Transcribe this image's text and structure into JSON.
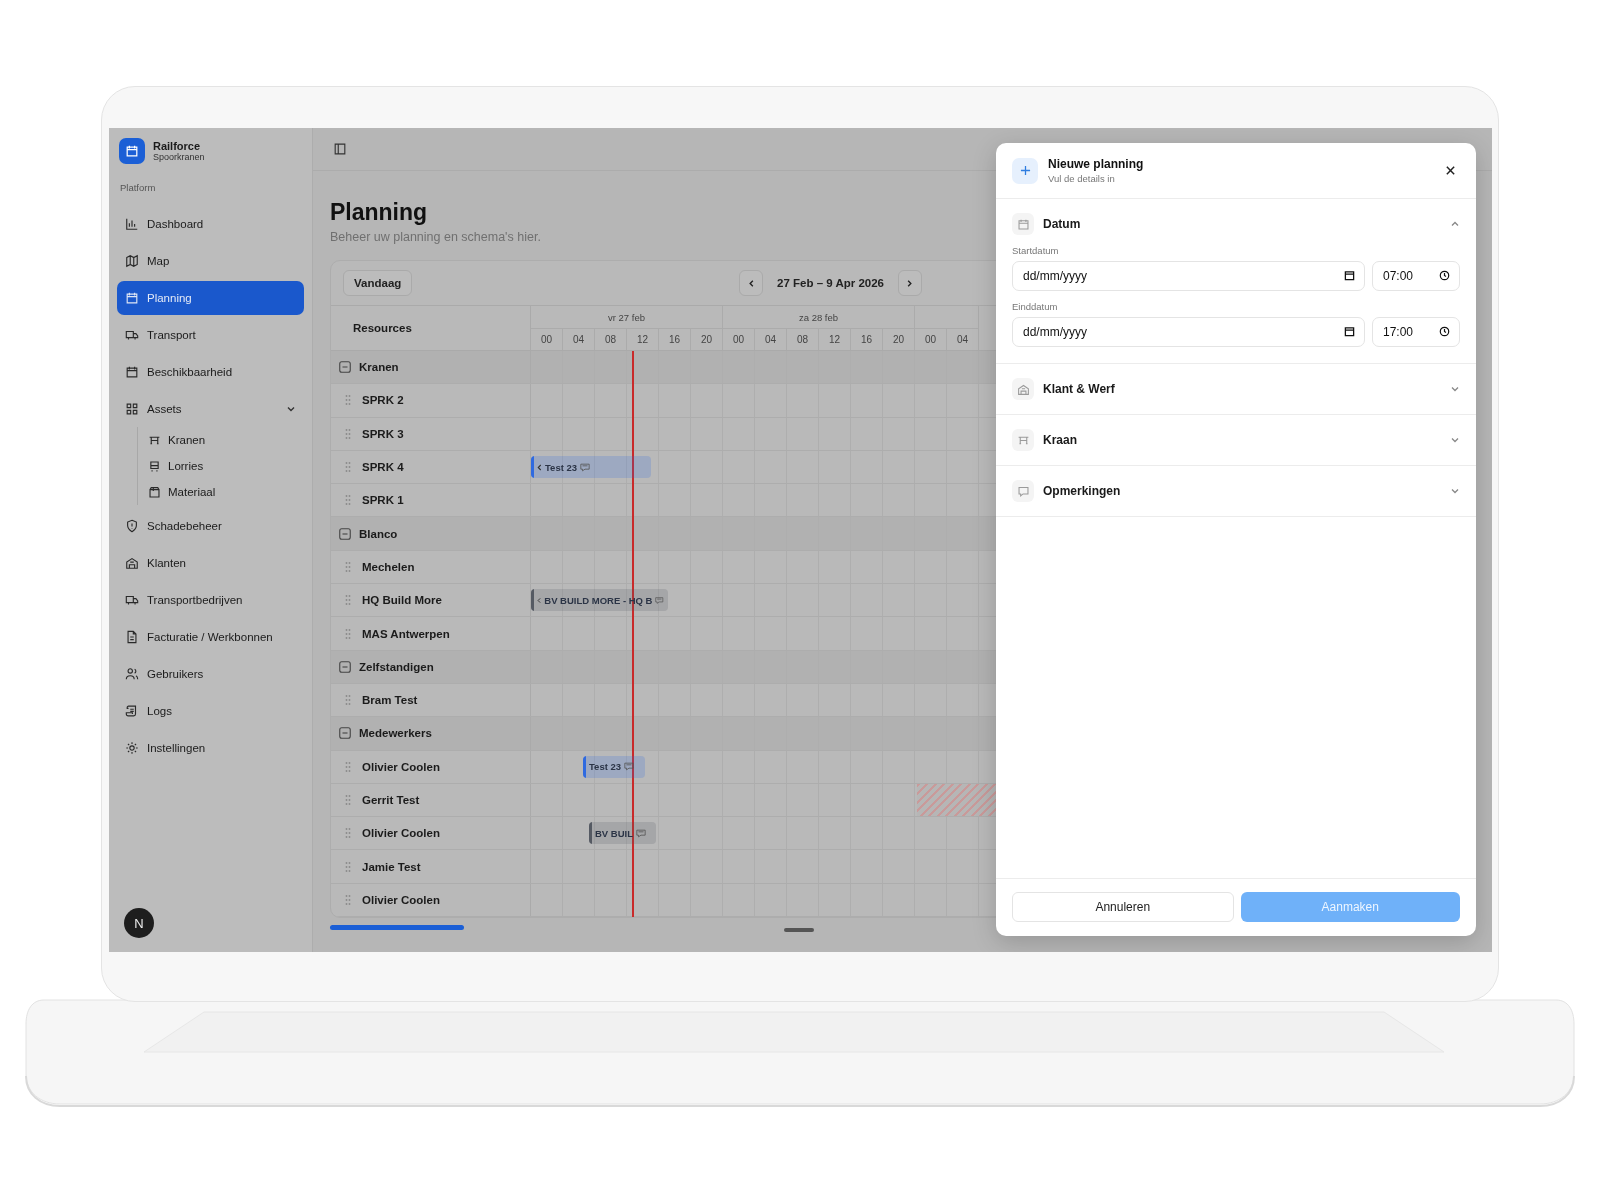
{
  "sidebar": {
    "brand": {
      "name": "Railforce",
      "subtitle": "Spoorkranen"
    },
    "section": "Platform",
    "items": [
      {
        "label": "Dashboard",
        "selected": false
      },
      {
        "label": "Map",
        "selected": false
      },
      {
        "label": "Planning",
        "selected": true
      },
      {
        "label": "Transport",
        "selected": false
      },
      {
        "label": "Beschikbaarheid",
        "selected": false
      },
      {
        "label": "Assets",
        "selected": false,
        "expanded": true,
        "children": [
          {
            "label": "Kranen",
            "selected": false
          },
          {
            "label": "Lorries",
            "selected": false
          },
          {
            "label": "Materiaal",
            "selected": false
          }
        ]
      },
      {
        "label": "Schadebeheer",
        "selected": false
      },
      {
        "label": "Klanten",
        "selected": false
      },
      {
        "label": "Transportbedrijven",
        "selected": false
      },
      {
        "label": "Facturatie / Werkbonnen",
        "selected": false
      },
      {
        "label": "Gebruikers",
        "selected": false
      },
      {
        "label": "Logs",
        "selected": false
      },
      {
        "label": "Instellingen",
        "selected": false
      }
    ],
    "avatar": "N"
  },
  "page": {
    "title": "Planning",
    "subtitle": "Beheer uw planning en schema's hier."
  },
  "scheduler": {
    "today_button": "Vandaag",
    "range": "27 Feb – 9 Apr 2026",
    "resources_header": "Resources",
    "days": [
      {
        "label": "vr 27 feb",
        "hours": [
          "00",
          "04",
          "08",
          "12",
          "16",
          "20"
        ]
      },
      {
        "label": "za 28 feb",
        "hours": [
          "00",
          "04",
          "08",
          "12",
          "16",
          "20"
        ]
      },
      {
        "hours": [
          "00",
          "04"
        ]
      }
    ],
    "groups": [
      {
        "name": "Kranen",
        "expanded": true,
        "resources": [
          {
            "name": "SPRK 2"
          },
          {
            "name": "SPRK 3"
          },
          {
            "name": "SPRK 4",
            "events": [
              {
                "label": "Test 23",
                "color": "#2f6ae0",
                "continues_left": true
              }
            ]
          },
          {
            "name": "SPRK 1"
          }
        ]
      },
      {
        "name": "Blanco",
        "expanded": true,
        "resources": [
          {
            "name": "Mechelen"
          },
          {
            "name": "HQ Build More",
            "events": [
              {
                "label": "BV BUILD MORE - HQ B",
                "color": "#555a63",
                "continues_left": true
              }
            ]
          },
          {
            "name": "MAS Antwerpen"
          }
        ]
      },
      {
        "name": "Zelfstandigen",
        "expanded": true,
        "resources": [
          {
            "name": "Bram Test"
          }
        ]
      },
      {
        "name": "Medewerkers",
        "expanded": true,
        "resources": [
          {
            "name": "Olivier Coolen",
            "events": [
              {
                "label": "Test 23",
                "color": "#2f6ae0",
                "continues_left": false
              }
            ]
          },
          {
            "name": "Gerrit Test",
            "unavailable": true
          },
          {
            "name": "Olivier Coolen",
            "events": [
              {
                "label": "BV BUIL",
                "color": "#555a63",
                "continues_left": false
              }
            ]
          },
          {
            "name": "Jamie Test"
          },
          {
            "name": "Olivier Coolen"
          }
        ]
      }
    ]
  },
  "dialog": {
    "title": "Nieuwe planning",
    "subtitle": "Vul de details in",
    "sections": [
      {
        "title": "Datum",
        "expanded": true,
        "fields": [
          {
            "label": "Startdatum",
            "placeholder": "dd/mm/yyyy",
            "time": "07:00"
          },
          {
            "label": "Einddatum",
            "placeholder": "dd/mm/yyyy",
            "time": "17:00"
          }
        ]
      },
      {
        "title": "Klant & Werf",
        "expanded": false
      },
      {
        "title": "Kraan",
        "expanded": false
      },
      {
        "title": "Opmerkingen",
        "expanded": false
      }
    ],
    "cancel_button": "Annuleren",
    "submit_button": {
      "label": "Aanmaken",
      "disabled": true
    }
  }
}
